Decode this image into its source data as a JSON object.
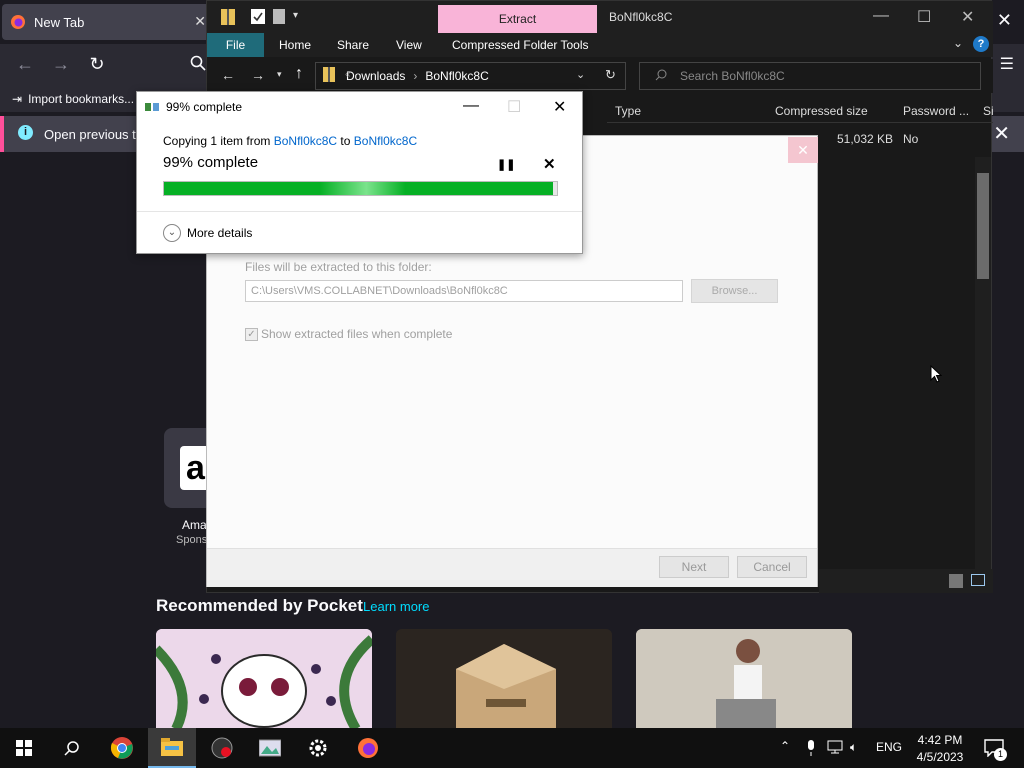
{
  "firefox": {
    "tab_title": "New Tab",
    "bookmarks_import": "Import bookmarks...",
    "info_bar_text": "Open previous ta",
    "shortcut_amazon": {
      "title": "Ama",
      "subtitle": "Spons"
    },
    "pocket_title": "Recommended by Pocket",
    "pocket_link": "Learn more",
    "card_images": [
      "skull-illustration",
      "amazon-prime-box",
      "woman-sitting"
    ]
  },
  "explorer": {
    "extract_tab": "Extract",
    "folder_name": "BoNfl0kc8C",
    "ribbon_tabs": {
      "file": "File",
      "home": "Home",
      "share": "Share",
      "view": "View",
      "compressed": "Compressed Folder Tools"
    },
    "breadcrumb": [
      "Downloads",
      "BoNfl0kc8C"
    ],
    "search_placeholder": "Search BoNfl0kc8C",
    "columns": {
      "type": "Type",
      "compressed_size": "Compressed size",
      "password": "Password ...",
      "size": "Si"
    },
    "row": {
      "compressed_size": "51,032 KB",
      "password": "No"
    }
  },
  "wizard": {
    "folder_label": "Files will be extracted to this folder:",
    "path_value": "C:\\Users\\VMS.COLLABNET\\Downloads\\BoNfl0kc8C",
    "browse": "Browse...",
    "show_files_label": "Show extracted files when complete",
    "next": "Next",
    "cancel": "Cancel"
  },
  "copy_dialog": {
    "title": "99% complete",
    "line_prefix": "Copying 1 item from",
    "from": "BoNfl0kc8C",
    "to_word": "to",
    "to": "BoNfl0kc8C",
    "percent_text": "99% complete",
    "progress": 0.99,
    "more_details": "More details"
  },
  "taskbar": {
    "language": "ENG",
    "time": "4:42 PM",
    "date": "4/5/2023",
    "notification_count": "1"
  },
  "colors": {
    "firefox_bg": "#1c1b22",
    "progress_green": "#06b025",
    "extract_pink": "#f9b4d8",
    "link_blue": "#0066cc"
  }
}
